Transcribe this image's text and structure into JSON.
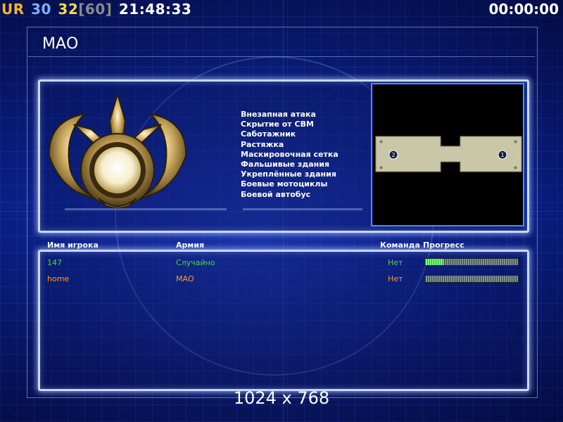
{
  "hud": {
    "tag": "UR",
    "fps_current": "30",
    "fps_alt": "32",
    "fps_max": "[60]",
    "clock": "21:48:33",
    "timer": "00:00:00"
  },
  "colors": {
    "hud_tag": "#f2b233",
    "hud_fps_current": "#7fb0ff",
    "hud_fps_alt": "#ffd84a",
    "hud_fps_max": "#8a8a8a",
    "player1": "#45d84a",
    "player2": "#ff9a2a"
  },
  "army": {
    "title": "МАО",
    "features": [
      "Внезапная атака",
      "Скрытие от СВМ",
      "Саботажник",
      "Растяжка",
      "Маскировочная сетка",
      "Фальшивые здания",
      "Укреплённые здания",
      "Боевые мотоциклы",
      "Боевой автобус"
    ]
  },
  "map": {
    "start_positions": [
      "2",
      "1"
    ]
  },
  "table": {
    "headers": {
      "player": "Имя игрока",
      "army": "Армия",
      "team": "Команда",
      "progress": "Прогресс"
    },
    "rows": [
      {
        "name": "147",
        "army": "Случайно",
        "team": "Нет",
        "progress": 0.2,
        "color": "#45d84a"
      },
      {
        "name": "home",
        "army": "МАО",
        "team": "Нет",
        "progress": 0.0,
        "color": "#ff9a2a"
      }
    ]
  },
  "resolution": "1024 x 768"
}
